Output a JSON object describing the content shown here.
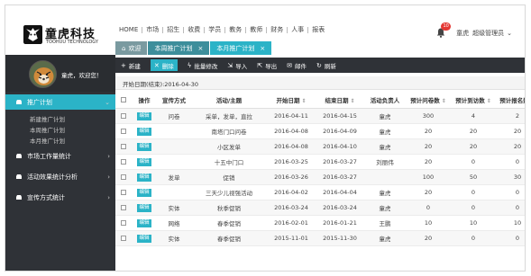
{
  "brand": {
    "name": "童虎科技",
    "subtitle": "TOOHUU TECHNOLOGY"
  },
  "topnav": [
    "HOME",
    "市场",
    "招生",
    "收费",
    "学员",
    "教务",
    "教师",
    "财务",
    "人事",
    "报表"
  ],
  "tabs": [
    {
      "label": "欢迎",
      "icon": "home-icon"
    },
    {
      "label": "本周推广计划",
      "close": "×"
    },
    {
      "label": "本月推广计划",
      "close": "×"
    }
  ],
  "user": {
    "notification_count": "10",
    "name": "童虎",
    "role": "超级管理员",
    "caret": "⌄"
  },
  "profile": {
    "welcome": "童虎，欢迎您！"
  },
  "sidebar": {
    "items": [
      {
        "label": "推广计划",
        "arrow": "⌄",
        "active": true
      },
      {
        "label": "市场工作量统计",
        "arrow": "›"
      },
      {
        "label": "活动效果统计分析",
        "arrow": "›"
      },
      {
        "label": "宣传方式统计",
        "arrow": "›"
      }
    ],
    "subitems": [
      "新建推广计划",
      "本周推广计划",
      "本月推广计划"
    ]
  },
  "toolbar": {
    "new": "新建",
    "delete": "删除",
    "batch_edit": "批量修改",
    "import": "导入",
    "export": "导出",
    "mail": "邮件",
    "refresh": "刷新"
  },
  "filter": {
    "text": "开始日期(结束):2016-04-30"
  },
  "table": {
    "headers": [
      "操作",
      "宣传方式",
      "活动/主题",
      "开始日期",
      "结束日期",
      "活动负责人",
      "预计问卷数",
      "预计到访数",
      "预计报名数"
    ],
    "edit_label": "编辑",
    "rows": [
      [
        "问卷",
        "采单，发单，直拉",
        "2016-04-11",
        "2016-04-15",
        "童虎",
        "300",
        "4",
        "2"
      ],
      [
        "",
        "南塔门口问卷",
        "2016-04-08",
        "2016-04-09",
        "童虎",
        "20",
        "20",
        "20"
      ],
      [
        "",
        "小区发单",
        "2016-04-08",
        "2016-04-10",
        "童虎",
        "20",
        "20",
        "20"
      ],
      [
        "",
        "十五中门口",
        "2016-03-25",
        "2016-03-27",
        "刘丽伟",
        "20",
        "0",
        "0"
      ],
      [
        "发单",
        "促销",
        "2016-03-26",
        "2016-03-27",
        "",
        "100",
        "50",
        "30"
      ],
      [
        "",
        "三天少儿视强活动",
        "2016-04-02",
        "2016-04-04",
        "童虎",
        "20",
        "0",
        "0"
      ],
      [
        "实体",
        "秋季促销",
        "2016-03-24",
        "2016-03-24",
        "童虎",
        "0",
        "0",
        "0"
      ],
      [
        "网络",
        "春季促销",
        "2016-02-01",
        "2016-01-21",
        "王鹏",
        "10",
        "10",
        "10"
      ],
      [
        "实体",
        "春季促销",
        "2015-11-01",
        "2015-11-30",
        "童虎",
        "20",
        "0",
        "0"
      ]
    ]
  },
  "colors": {
    "accent": "#2bb3c7",
    "sidebar": "#2f3237",
    "badge": "#e53935"
  }
}
